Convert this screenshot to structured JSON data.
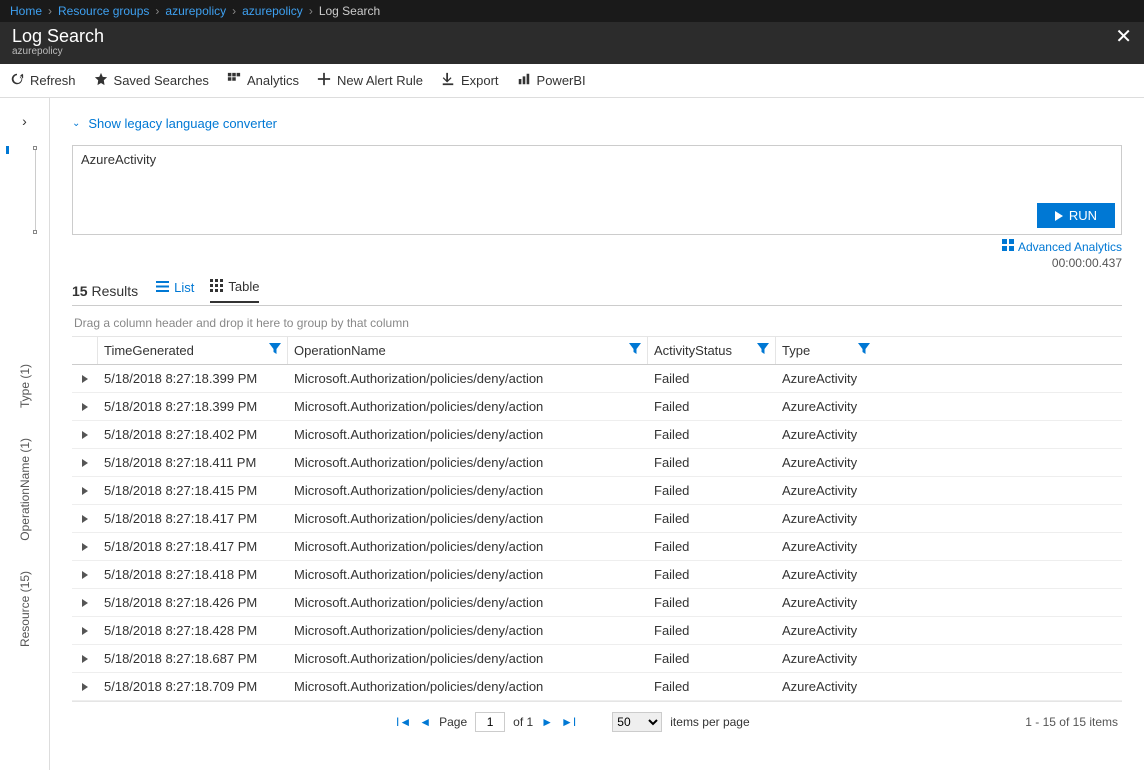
{
  "breadcrumbs": [
    {
      "label": "Home",
      "link": true
    },
    {
      "label": "Resource groups",
      "link": true
    },
    {
      "label": "azurepolicy",
      "link": true
    },
    {
      "label": "azurepolicy",
      "link": true
    },
    {
      "label": "Log Search",
      "link": false
    }
  ],
  "header": {
    "title": "Log Search",
    "subtitle": "azurepolicy"
  },
  "toolbar": {
    "refresh": "Refresh",
    "saved": "Saved Searches",
    "analytics": "Analytics",
    "newAlert": "New Alert Rule",
    "export": "Export",
    "powerbi": "PowerBI"
  },
  "leftRail": {
    "tabs": [
      "Type (1)",
      "OperationName (1)",
      "Resource (15)"
    ]
  },
  "legacyLink": "Show legacy language converter",
  "query": "AzureActivity",
  "runLabel": "RUN",
  "advancedLink": "Advanced Analytics",
  "timing": "00:00:00.437",
  "results": {
    "count": "15",
    "label": "Results",
    "listLabel": "List",
    "tableLabel": "Table"
  },
  "groupHint": "Drag a column header and drop it here to group by that column",
  "columns": {
    "time": "TimeGenerated",
    "op": "OperationName",
    "status": "ActivityStatus",
    "type": "Type"
  },
  "rows": [
    {
      "time": "5/18/2018 8:27:18.399 PM",
      "op": "Microsoft.Authorization/policies/deny/action",
      "status": "Failed",
      "type": "AzureActivity"
    },
    {
      "time": "5/18/2018 8:27:18.399 PM",
      "op": "Microsoft.Authorization/policies/deny/action",
      "status": "Failed",
      "type": "AzureActivity"
    },
    {
      "time": "5/18/2018 8:27:18.402 PM",
      "op": "Microsoft.Authorization/policies/deny/action",
      "status": "Failed",
      "type": "AzureActivity"
    },
    {
      "time": "5/18/2018 8:27:18.411 PM",
      "op": "Microsoft.Authorization/policies/deny/action",
      "status": "Failed",
      "type": "AzureActivity"
    },
    {
      "time": "5/18/2018 8:27:18.415 PM",
      "op": "Microsoft.Authorization/policies/deny/action",
      "status": "Failed",
      "type": "AzureActivity"
    },
    {
      "time": "5/18/2018 8:27:18.417 PM",
      "op": "Microsoft.Authorization/policies/deny/action",
      "status": "Failed",
      "type": "AzureActivity"
    },
    {
      "time": "5/18/2018 8:27:18.417 PM",
      "op": "Microsoft.Authorization/policies/deny/action",
      "status": "Failed",
      "type": "AzureActivity"
    },
    {
      "time": "5/18/2018 8:27:18.418 PM",
      "op": "Microsoft.Authorization/policies/deny/action",
      "status": "Failed",
      "type": "AzureActivity"
    },
    {
      "time": "5/18/2018 8:27:18.426 PM",
      "op": "Microsoft.Authorization/policies/deny/action",
      "status": "Failed",
      "type": "AzureActivity"
    },
    {
      "time": "5/18/2018 8:27:18.428 PM",
      "op": "Microsoft.Authorization/policies/deny/action",
      "status": "Failed",
      "type": "AzureActivity"
    },
    {
      "time": "5/18/2018 8:27:18.687 PM",
      "op": "Microsoft.Authorization/policies/deny/action",
      "status": "Failed",
      "type": "AzureActivity"
    },
    {
      "time": "5/18/2018 8:27:18.709 PM",
      "op": "Microsoft.Authorization/policies/deny/action",
      "status": "Failed",
      "type": "AzureActivity"
    }
  ],
  "pager": {
    "pageLabel": "Page",
    "page": "1",
    "of": "of 1",
    "perPage": "50",
    "perPageLabel": "items per page",
    "range": "1 - 15 of 15 items"
  }
}
